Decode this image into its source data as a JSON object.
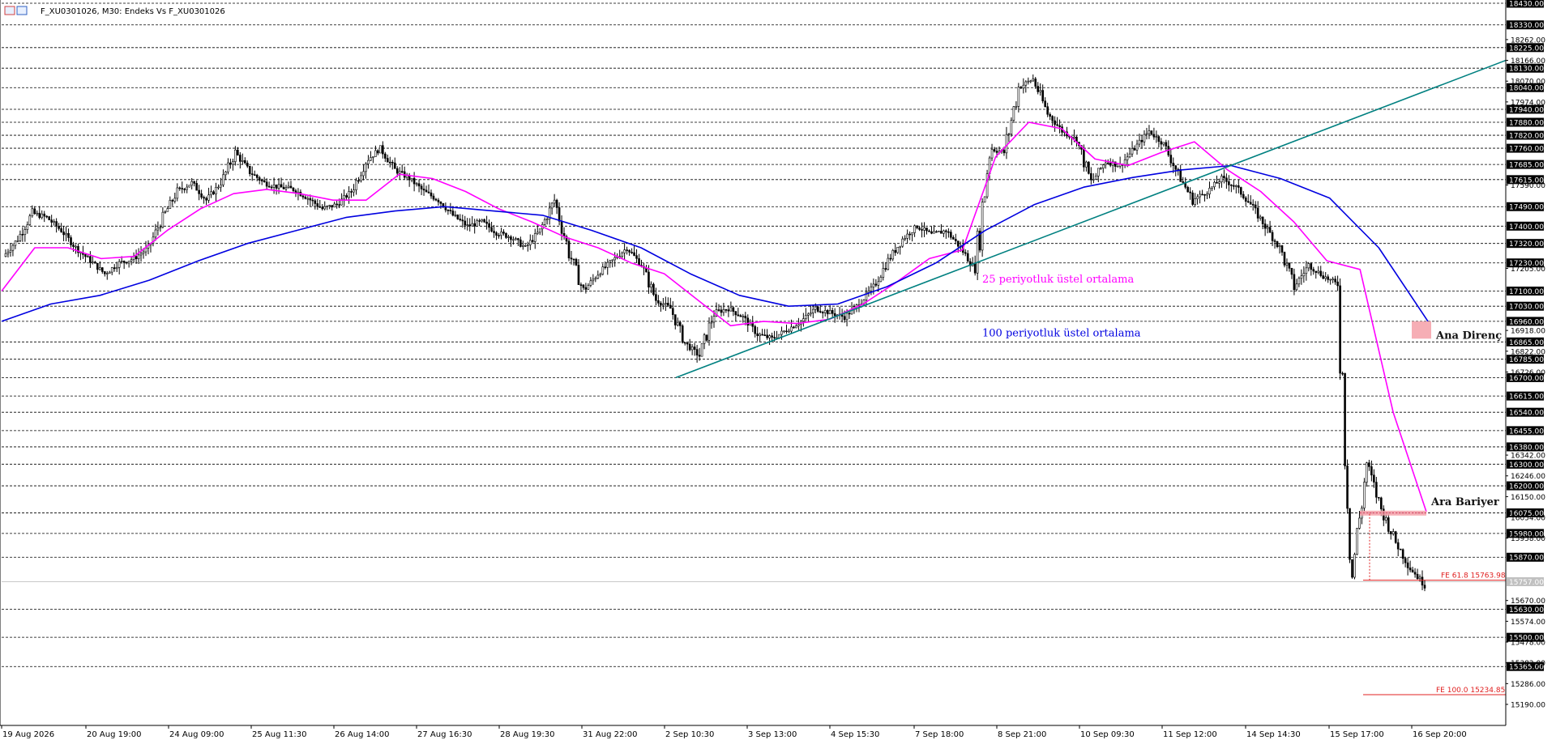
{
  "window": {
    "title": "F_XU0301026, M30:  Endeks Vs F_XU0301026",
    "icon": "chart-window-icon"
  },
  "colors": {
    "background": "#ffffff",
    "grid": "#000000",
    "candle": "#000000",
    "ema25": "#ff00ff",
    "ema100": "#0000e0",
    "trendline": "#008080",
    "fibo": "#e02020",
    "zone": "#f4a0a8",
    "label_bg": "#000000",
    "label_text": "#ffffff"
  },
  "chart_data": {
    "type": "candlestick",
    "symbol": "F_XU0301026",
    "timeframe": "M30",
    "ylim": [
      15120,
      18430
    ],
    "price_levels": [
      18430,
      18330,
      18225,
      18130,
      18040,
      17940,
      17880,
      17820,
      17760,
      17685,
      17615,
      17490,
      17400,
      17320,
      17230,
      17100,
      17030,
      16960,
      16865,
      16785,
      16700,
      16615,
      16540,
      16455,
      16380,
      16300,
      16200,
      16075,
      15980,
      15870,
      15630,
      15500,
      15365
    ],
    "minor_levels": [
      18262,
      18166,
      18070,
      17974,
      17590,
      17205,
      16918,
      16822,
      16726,
      16342,
      16246,
      16150,
      16054,
      15958,
      15670,
      15574,
      15478,
      15382,
      15286,
      15190
    ],
    "current_price_label": "15757.00",
    "current_price": 15757,
    "time_labels": [
      "19 Aug 2026",
      "20 Aug 19:00",
      "24 Aug 09:00",
      "25 Aug 11:30",
      "26 Aug 14:00",
      "27 Aug 16:30",
      "28 Aug 19:30",
      "31 Aug 22:00",
      "2 Sep 10:30",
      "3 Sep 13:00",
      "4 Sep 15:30",
      "7 Sep 18:00",
      "8 Sep 21:00",
      "10 Sep 09:30",
      "11 Sep 12:00",
      "14 Sep 14:30",
      "15 Sep 17:00",
      "16 Sep 20:00"
    ],
    "close_path": [
      17260,
      17340,
      17460,
      17440,
      17380,
      17300,
      17240,
      17180,
      17230,
      17250,
      17300,
      17440,
      17560,
      17600,
      17520,
      17600,
      17740,
      17650,
      17600,
      17580,
      17570,
      17530,
      17480,
      17500,
      17560,
      17700,
      17760,
      17660,
      17620,
      17560,
      17520,
      17450,
      17400,
      17420,
      17370,
      17350,
      17300,
      17380,
      17520,
      17280,
      17100,
      17180,
      17240,
      17300,
      17220,
      17060,
      17020,
      16860,
      16800,
      17000,
      17020,
      16980,
      16900,
      16880,
      16920,
      16960,
      17020,
      17000,
      16980,
      17040,
      17120,
      17240,
      17340,
      17400,
      17360,
      17380,
      17300,
      17200,
      17760,
      17740,
      18040,
      18080,
      17920,
      17840,
      17800,
      17600,
      17700,
      17680,
      17760,
      17840,
      17780,
      17640,
      17520,
      17560,
      17620,
      17580,
      17500,
      17400,
      17300,
      17120,
      17220,
      17170,
      17130,
      15800,
      16300,
      16090,
      15940,
      15820,
      15740
    ],
    "ema25": [
      17100,
      17300,
      17300,
      17250,
      17260,
      17380,
      17480,
      17550,
      17570,
      17550,
      17520,
      17520,
      17640,
      17620,
      17560,
      17480,
      17420,
      17350,
      17300,
      17230,
      17180,
      17060,
      16940,
      16960,
      16950,
      16970,
      17040,
      17140,
      17250,
      17290,
      17720,
      17880,
      17850,
      17710,
      17680,
      17740,
      17790,
      17660,
      17560,
      17420,
      17240,
      17200,
      16540,
      16080
    ],
    "ema100": [
      16960,
      17040,
      17080,
      17150,
      17240,
      17320,
      17380,
      17440,
      17470,
      17490,
      17470,
      17450,
      17380,
      17300,
      17180,
      17080,
      17030,
      17040,
      17120,
      17230,
      17380,
      17500,
      17580,
      17625,
      17660,
      17680,
      17620,
      17530,
      17300,
      16960
    ],
    "trendline": {
      "from": [
        17300,
        16700
      ],
      "to": [
        18200,
        18166
      ]
    },
    "trendline_upper": {
      "note": "support extended"
    },
    "fe_levels": [
      {
        "label": "FE 61.8 15763.98",
        "value": 15763.98
      },
      {
        "label": "FE 100.0 15234.85",
        "value": 15234.85
      }
    ],
    "annotations": [
      {
        "text": "25 periyotluk üstel ortalama",
        "color": "#ff00ff"
      },
      {
        "text": "100 periyotluk üstel ortalama",
        "color": "#0000e0"
      },
      {
        "text": "Ana Direnç",
        "color": "#111111"
      },
      {
        "text": "Ara Bariyer",
        "color": "#111111"
      }
    ],
    "zones": [
      {
        "name": "Ana Direnç",
        "low": 16880,
        "high": 16960
      },
      {
        "name": "Ara Bariyer",
        "low": 16065,
        "high": 16085
      }
    ]
  }
}
